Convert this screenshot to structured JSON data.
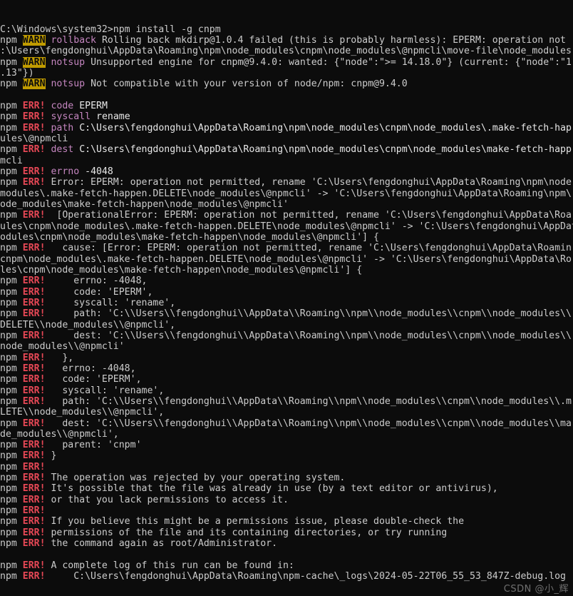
{
  "window": {
    "type": "windows-command-prompt",
    "background_color": "#0c0c0c",
    "default_text_color": "#cccccc"
  },
  "palette": {
    "error_red": "#e74856",
    "warn_badge_bg": "#c19c00",
    "warn_badge_fg": "#0c0c0c",
    "magenta": "#b4009e",
    "magenta_bright": "#c586c0",
    "white": "#e8e8e8"
  },
  "prompt": {
    "path": "C:\\Windows\\system32>",
    "command": "npm install -g cnpm"
  },
  "watermark": "CSDN @小_辉",
  "terminal_lines": [
    {
      "id": "prompt-line",
      "segments": [
        {
          "style": "default",
          "text": "C:\\Windows\\system32>npm install -g cnpm"
        }
      ]
    },
    {
      "id": "warn-rollback",
      "segments": [
        {
          "style": "prefix",
          "text": "npm "
        },
        {
          "style": "warn-badge",
          "text": "WARN"
        },
        {
          "style": "default",
          "text": " "
        },
        {
          "style": "magenta",
          "text": "rollback"
        },
        {
          "style": "default",
          "text": " Rolling back mkdirp@1.0.4 failed (this is probably harmless): EPERM: operation not"
        }
      ]
    },
    {
      "id": "warn-rollback-wrap",
      "segments": [
        {
          "style": "default",
          "text": ":\\Users\\fengdonghui\\AppData\\Roaming\\npm\\node_modules\\cnpm\\node_modules\\@npmcli\\move-file\\node_modules"
        }
      ]
    },
    {
      "id": "warn-notsup-1",
      "segments": [
        {
          "style": "prefix",
          "text": "npm "
        },
        {
          "style": "warn-badge",
          "text": "WARN"
        },
        {
          "style": "default",
          "text": " "
        },
        {
          "style": "magenta",
          "text": "notsup"
        },
        {
          "style": "default",
          "text": " Unsupported engine for cnpm@9.4.0: wanted: {\"node\":\">= 14.18.0\"} (current: {\"node\":\"1"
        }
      ]
    },
    {
      "id": "warn-notsup-1-wrap",
      "segments": [
        {
          "style": "default",
          "text": ".13\"})"
        }
      ]
    },
    {
      "id": "warn-notsup-2",
      "segments": [
        {
          "style": "prefix",
          "text": "npm "
        },
        {
          "style": "warn-badge",
          "text": "WARN"
        },
        {
          "style": "default",
          "text": " "
        },
        {
          "style": "magenta",
          "text": "notsup"
        },
        {
          "style": "default",
          "text": " Not compatible with your version of node/npm: cnpm@9.4.0"
        }
      ]
    },
    {
      "id": "blank-1",
      "segments": [
        {
          "style": "default",
          "text": ""
        }
      ]
    },
    {
      "id": "err-code",
      "segments": [
        {
          "style": "prefix",
          "text": "npm "
        },
        {
          "style": "err",
          "text": "ERR!"
        },
        {
          "style": "default",
          "text": " "
        },
        {
          "style": "magenta",
          "text": "code"
        },
        {
          "style": "white",
          "text": " EPERM"
        }
      ]
    },
    {
      "id": "err-syscall",
      "segments": [
        {
          "style": "prefix",
          "text": "npm "
        },
        {
          "style": "err",
          "text": "ERR!"
        },
        {
          "style": "default",
          "text": " "
        },
        {
          "style": "magenta",
          "text": "syscall"
        },
        {
          "style": "white",
          "text": " rename"
        }
      ]
    },
    {
      "id": "err-path",
      "segments": [
        {
          "style": "prefix",
          "text": "npm "
        },
        {
          "style": "err",
          "text": "ERR!"
        },
        {
          "style": "default",
          "text": " "
        },
        {
          "style": "magenta",
          "text": "path"
        },
        {
          "style": "white",
          "text": " C:\\Users\\fengdonghui\\AppData\\Roaming\\npm\\node_modules\\cnpm\\node_modules\\.make-fetch-hap"
        }
      ]
    },
    {
      "id": "err-path-wrap",
      "segments": [
        {
          "style": "default",
          "text": "ules\\@npmcli"
        }
      ]
    },
    {
      "id": "err-dest",
      "segments": [
        {
          "style": "prefix",
          "text": "npm "
        },
        {
          "style": "err",
          "text": "ERR!"
        },
        {
          "style": "default",
          "text": " "
        },
        {
          "style": "magenta",
          "text": "dest"
        },
        {
          "style": "white",
          "text": " C:\\Users\\fengdonghui\\AppData\\Roaming\\npm\\node_modules\\cnpm\\node_modules\\make-fetch-happ"
        }
      ]
    },
    {
      "id": "err-dest-wrap",
      "segments": [
        {
          "style": "default",
          "text": "mcli"
        }
      ]
    },
    {
      "id": "err-errno",
      "segments": [
        {
          "style": "prefix",
          "text": "npm "
        },
        {
          "style": "err",
          "text": "ERR!"
        },
        {
          "style": "default",
          "text": " "
        },
        {
          "style": "magenta",
          "text": "errno"
        },
        {
          "style": "white",
          "text": " -4048"
        }
      ]
    },
    {
      "id": "err-error-eperm",
      "segments": [
        {
          "style": "prefix",
          "text": "npm "
        },
        {
          "style": "err",
          "text": "ERR!"
        },
        {
          "style": "default",
          "text": " Error: EPERM: operation not permitted, rename 'C:\\Users\\fengdonghui\\AppData\\Roaming\\npm\\node"
        }
      ]
    },
    {
      "id": "err-error-eperm-wrap1",
      "segments": [
        {
          "style": "default",
          "text": "modules\\.make-fetch-happen.DELETE\\node_modules\\@npmcli' -> 'C:\\Users\\fengdonghui\\AppData\\Roaming\\npm\\"
        }
      ]
    },
    {
      "id": "err-error-eperm-wrap2",
      "segments": [
        {
          "style": "default",
          "text": "ode_modules\\make-fetch-happen\\node_modules\\@npmcli'"
        }
      ]
    },
    {
      "id": "err-operational",
      "segments": [
        {
          "style": "prefix",
          "text": "npm "
        },
        {
          "style": "err",
          "text": "ERR!"
        },
        {
          "style": "default",
          "text": "  [OperationalError: EPERM: operation not permitted, rename 'C:\\Users\\fengdonghui\\AppData\\Roa"
        }
      ]
    },
    {
      "id": "err-operational-wrap1",
      "segments": [
        {
          "style": "default",
          "text": "ules\\cnpm\\node_modules\\.make-fetch-happen.DELETE\\node_modules\\@npmcli' -> 'C:\\Users\\fengdonghui\\AppData"
        }
      ]
    },
    {
      "id": "err-operational-wrap2",
      "segments": [
        {
          "style": "default",
          "text": "odules\\cnpm\\node_modules\\make-fetch-happen\\node_modules\\@npmcli'] {"
        }
      ]
    },
    {
      "id": "err-cause",
      "segments": [
        {
          "style": "prefix",
          "text": "npm "
        },
        {
          "style": "err",
          "text": "ERR!"
        },
        {
          "style": "default",
          "text": "   cause: [Error: EPERM: operation not permitted, rename 'C:\\Users\\fengdonghui\\AppData\\Roamin"
        }
      ]
    },
    {
      "id": "err-cause-wrap1",
      "segments": [
        {
          "style": "default",
          "text": "cnpm\\node_modules\\.make-fetch-happen.DELETE\\node_modules\\@npmcli' -> 'C:\\Users\\fengdonghui\\AppData\\Ro"
        }
      ]
    },
    {
      "id": "err-cause-wrap2",
      "segments": [
        {
          "style": "default",
          "text": "les\\cnpm\\node_modules\\make-fetch-happen\\node_modules\\@npmcli'] {"
        }
      ]
    },
    {
      "id": "err-cause-errno",
      "segments": [
        {
          "style": "prefix",
          "text": "npm "
        },
        {
          "style": "err",
          "text": "ERR!"
        },
        {
          "style": "default",
          "text": "     errno: -4048,"
        }
      ]
    },
    {
      "id": "err-cause-code",
      "segments": [
        {
          "style": "prefix",
          "text": "npm "
        },
        {
          "style": "err",
          "text": "ERR!"
        },
        {
          "style": "default",
          "text": "     code: 'EPERM',"
        }
      ]
    },
    {
      "id": "err-cause-syscall",
      "segments": [
        {
          "style": "prefix",
          "text": "npm "
        },
        {
          "style": "err",
          "text": "ERR!"
        },
        {
          "style": "default",
          "text": "     syscall: 'rename',"
        }
      ]
    },
    {
      "id": "err-cause-path",
      "segments": [
        {
          "style": "prefix",
          "text": "npm "
        },
        {
          "style": "err",
          "text": "ERR!"
        },
        {
          "style": "default",
          "text": "     path: 'C:\\\\Users\\\\fengdonghui\\\\AppData\\\\Roaming\\\\npm\\\\node_modules\\\\cnpm\\\\node_modules\\\\"
        }
      ]
    },
    {
      "id": "err-cause-path-wrap",
      "segments": [
        {
          "style": "default",
          "text": "DELETE\\\\node_modules\\\\@npmcli',"
        }
      ]
    },
    {
      "id": "err-cause-dest",
      "segments": [
        {
          "style": "prefix",
          "text": "npm "
        },
        {
          "style": "err",
          "text": "ERR!"
        },
        {
          "style": "default",
          "text": "     dest: 'C:\\\\Users\\\\fengdonghui\\\\AppData\\\\Roaming\\\\npm\\\\node_modules\\\\cnpm\\\\node_modules\\\\"
        }
      ]
    },
    {
      "id": "err-cause-dest-wrap",
      "segments": [
        {
          "style": "default",
          "text": "node_modules\\\\@npmcli'"
        }
      ]
    },
    {
      "id": "err-cause-close",
      "segments": [
        {
          "style": "prefix",
          "text": "npm "
        },
        {
          "style": "err",
          "text": "ERR!"
        },
        {
          "style": "default",
          "text": "   },"
        }
      ]
    },
    {
      "id": "err-outer-errno",
      "segments": [
        {
          "style": "prefix",
          "text": "npm "
        },
        {
          "style": "err",
          "text": "ERR!"
        },
        {
          "style": "default",
          "text": "   errno: -4048,"
        }
      ]
    },
    {
      "id": "err-outer-code",
      "segments": [
        {
          "style": "prefix",
          "text": "npm "
        },
        {
          "style": "err",
          "text": "ERR!"
        },
        {
          "style": "default",
          "text": "   code: 'EPERM',"
        }
      ]
    },
    {
      "id": "err-outer-syscall",
      "segments": [
        {
          "style": "prefix",
          "text": "npm "
        },
        {
          "style": "err",
          "text": "ERR!"
        },
        {
          "style": "default",
          "text": "   syscall: 'rename',"
        }
      ]
    },
    {
      "id": "err-outer-path",
      "segments": [
        {
          "style": "prefix",
          "text": "npm "
        },
        {
          "style": "err",
          "text": "ERR!"
        },
        {
          "style": "default",
          "text": "   path: 'C:\\\\Users\\\\fengdonghui\\\\AppData\\\\Roaming\\\\npm\\\\node_modules\\\\cnpm\\\\node_modules\\\\.m"
        }
      ]
    },
    {
      "id": "err-outer-path-wrap",
      "segments": [
        {
          "style": "default",
          "text": "LETE\\\\node_modules\\\\@npmcli',"
        }
      ]
    },
    {
      "id": "err-outer-dest",
      "segments": [
        {
          "style": "prefix",
          "text": "npm "
        },
        {
          "style": "err",
          "text": "ERR!"
        },
        {
          "style": "default",
          "text": "   dest: 'C:\\\\Users\\\\fengdonghui\\\\AppData\\\\Roaming\\\\npm\\\\node_modules\\\\cnpm\\\\node_modules\\\\ma"
        }
      ]
    },
    {
      "id": "err-outer-dest-wrap",
      "segments": [
        {
          "style": "default",
          "text": "de_modules\\\\@npmcli',"
        }
      ]
    },
    {
      "id": "err-parent",
      "segments": [
        {
          "style": "prefix",
          "text": "npm "
        },
        {
          "style": "err",
          "text": "ERR!"
        },
        {
          "style": "default",
          "text": "   parent: 'cnpm'"
        }
      ]
    },
    {
      "id": "err-close-brace",
      "segments": [
        {
          "style": "prefix",
          "text": "npm "
        },
        {
          "style": "err",
          "text": "ERR!"
        },
        {
          "style": "default",
          "text": " }"
        }
      ]
    },
    {
      "id": "err-blank-1",
      "segments": [
        {
          "style": "prefix",
          "text": "npm "
        },
        {
          "style": "err",
          "text": "ERR!"
        }
      ]
    },
    {
      "id": "err-msg-rejected",
      "segments": [
        {
          "style": "prefix",
          "text": "npm "
        },
        {
          "style": "err",
          "text": "ERR!"
        },
        {
          "style": "default",
          "text": " The operation was rejected by your operating system."
        }
      ]
    },
    {
      "id": "err-msg-inuse",
      "segments": [
        {
          "style": "prefix",
          "text": "npm "
        },
        {
          "style": "err",
          "text": "ERR!"
        },
        {
          "style": "default",
          "text": " It's possible that the file was already in use (by a text editor or antivirus),"
        }
      ]
    },
    {
      "id": "err-msg-permissions",
      "segments": [
        {
          "style": "prefix",
          "text": "npm "
        },
        {
          "style": "err",
          "text": "ERR!"
        },
        {
          "style": "default",
          "text": " or that you lack permissions to access it."
        }
      ]
    },
    {
      "id": "err-blank-2",
      "segments": [
        {
          "style": "prefix",
          "text": "npm "
        },
        {
          "style": "err",
          "text": "ERR!"
        }
      ]
    },
    {
      "id": "err-msg-believe",
      "segments": [
        {
          "style": "prefix",
          "text": "npm "
        },
        {
          "style": "err",
          "text": "ERR!"
        },
        {
          "style": "default",
          "text": " If you believe this might be a permissions issue, please double-check the"
        }
      ]
    },
    {
      "id": "err-msg-dirs",
      "segments": [
        {
          "style": "prefix",
          "text": "npm "
        },
        {
          "style": "err",
          "text": "ERR!"
        },
        {
          "style": "default",
          "text": " permissions of the file and its containing directories, or try running"
        }
      ]
    },
    {
      "id": "err-msg-admin",
      "segments": [
        {
          "style": "prefix",
          "text": "npm "
        },
        {
          "style": "err",
          "text": "ERR!"
        },
        {
          "style": "default",
          "text": " the command again as root/Administrator."
        }
      ]
    },
    {
      "id": "blank-2",
      "segments": [
        {
          "style": "default",
          "text": ""
        }
      ]
    },
    {
      "id": "err-log-intro",
      "segments": [
        {
          "style": "prefix",
          "text": "npm "
        },
        {
          "style": "err",
          "text": "ERR!"
        },
        {
          "style": "default",
          "text": " A complete log of this run can be found in:"
        }
      ]
    },
    {
      "id": "err-log-path",
      "segments": [
        {
          "style": "prefix",
          "text": "npm "
        },
        {
          "style": "err",
          "text": "ERR!"
        },
        {
          "style": "default",
          "text": "     C:\\Users\\fengdonghui\\AppData\\Roaming\\npm-cache\\_logs\\2024-05-22T06_55_53_847Z-debug.log"
        }
      ]
    }
  ]
}
